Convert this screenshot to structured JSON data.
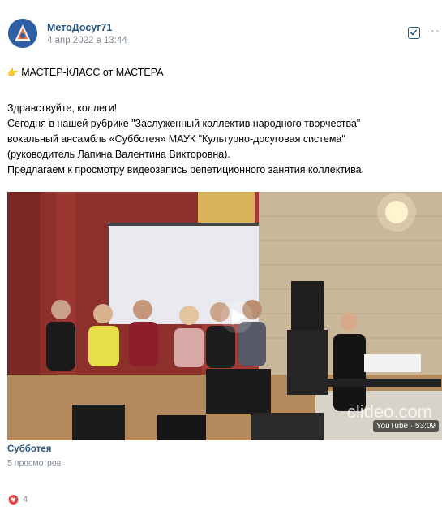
{
  "post": {
    "author": "МетоДосуг71",
    "date": "4 апр 2022 в 13:44",
    "heading_icon": "👉",
    "heading": "МАСТЕР-КЛАСС от МАСТЕРА",
    "lines": [
      "Здравствуйте, коллеги!",
      "Сегодня в нашей рубрике \"Заслуженный коллектив народного творчества\"",
      "вокальный ансамбль «Субботея» МАУК \"Культурно-досуговая система\"",
      "(руководитель Лапина Валентина Викторовна).",
      "Предлагаем к просмотру видеозапись репетиционного занятия коллектива."
    ]
  },
  "video": {
    "title": "Субботея",
    "views": "5 просмотров",
    "watermark": "clideo.com",
    "duration": "YouTube · 53:09"
  },
  "likes": {
    "count": "4"
  },
  "colors": {
    "link": "#2a5885",
    "muted": "#818c99",
    "like": "#e64646"
  },
  "icons": {
    "check": "check-square-icon",
    "more": "more-horizontal-icon",
    "play": "play-icon",
    "heart": "heart-icon"
  }
}
